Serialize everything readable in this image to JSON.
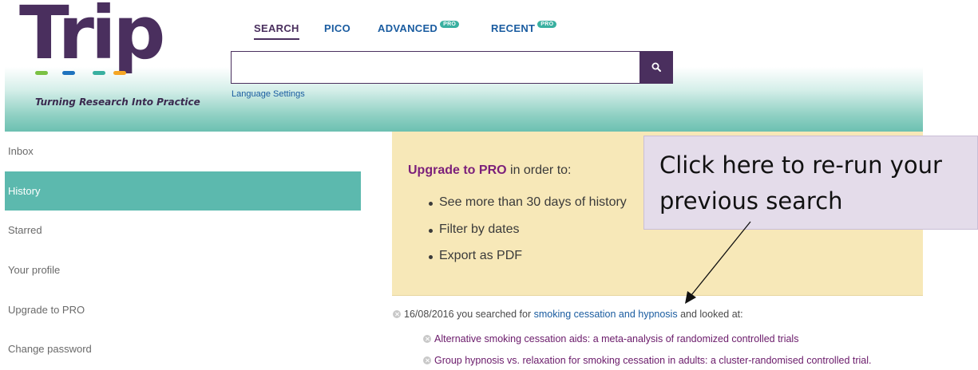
{
  "logo": {
    "word": "Trip",
    "tagline": "Turning Research Into Practice",
    "dot_colors": [
      "#7ac143",
      "#1e73be",
      "#39b0a0",
      "#f5a623"
    ]
  },
  "tabs": [
    {
      "label": "SEARCH",
      "active": true,
      "pro": false
    },
    {
      "label": "PICO",
      "active": false,
      "pro": false
    },
    {
      "label": "ADVANCED",
      "active": false,
      "pro": true
    },
    {
      "label": "RECENT",
      "active": false,
      "pro": true
    }
  ],
  "pro_badge": "PRO",
  "search": {
    "value": "",
    "placeholder": "",
    "button_icon": "search-icon"
  },
  "language_settings": "Language Settings",
  "sidebar": {
    "items": [
      {
        "label": "Inbox",
        "active": false
      },
      {
        "label": "History",
        "active": true
      },
      {
        "label": "Starred",
        "active": false
      },
      {
        "label": "Your profile",
        "active": false
      },
      {
        "label": "Upgrade to PRO",
        "active": false
      },
      {
        "label": "Change password",
        "active": false
      }
    ]
  },
  "upgrade": {
    "link": "Upgrade to PRO",
    "suffix": " in order to:",
    "benefits": [
      "See more than 30 days of history",
      "Filter by dates",
      "Export as PDF"
    ]
  },
  "callout": {
    "line1": "Click here to re-run your",
    "line2": "previous search"
  },
  "history": {
    "date": "16/08/2016",
    "prefix": " you searched for ",
    "query": "smoking cessation and hypnosis",
    "suffix": " and looked at:",
    "results": [
      "Alternative smoking cessation aids: a meta-analysis of randomized controlled trials",
      "Group hypnosis vs. relaxation for smoking cessation in adults: a cluster-randomised controlled trial."
    ]
  },
  "colors": {
    "brand_purple": "#4a2f5e",
    "teal": "#5cb9ae",
    "link_blue": "#1a5ca0",
    "pro_magenta": "#7b1f7a",
    "panel_yellow": "#f7e8b8",
    "callout_lavender": "#e4dcea"
  }
}
